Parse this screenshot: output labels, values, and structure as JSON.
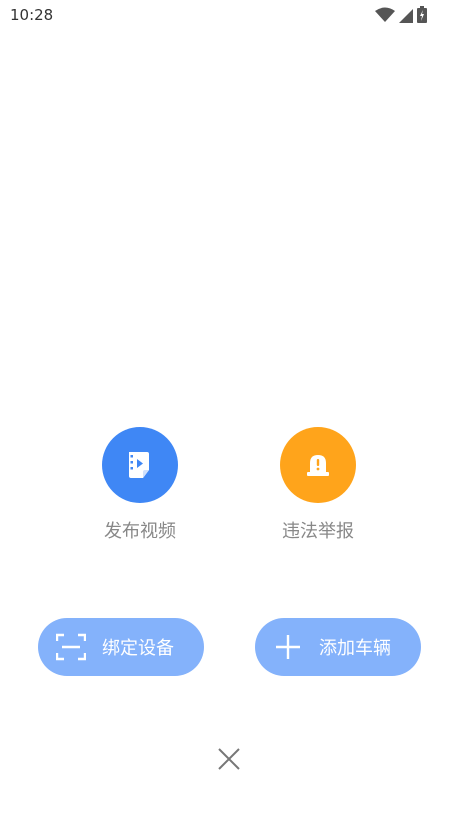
{
  "status_bar": {
    "time": "10:28",
    "icons": [
      "wifi-icon",
      "signal-icon",
      "battery-charging-icon"
    ]
  },
  "actions": [
    {
      "label": "发布视频",
      "icon": "video-publish-icon",
      "color": "#3f87f5"
    },
    {
      "label": "违法举报",
      "icon": "alarm-report-icon",
      "color": "#ffa41b"
    }
  ],
  "buttons": {
    "bind_device": {
      "label": "绑定设备",
      "icon": "scan-icon"
    },
    "add_vehicle": {
      "label": "添加车辆",
      "icon": "plus-icon"
    }
  },
  "close": {
    "icon": "close-icon"
  },
  "colors": {
    "pill": "#84b2fb",
    "background": "#ffffff"
  }
}
